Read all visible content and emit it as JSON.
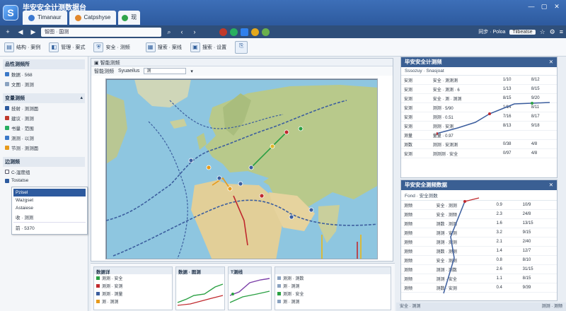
{
  "window": {
    "app_title": "毕安安全计测数据台",
    "tabs": [
      "Timanaur",
      "Catpshyse",
      "现"
    ],
    "controls": [
      "—",
      "▢",
      "✕"
    ]
  },
  "addressbar": {
    "url": "智图 · 国测",
    "right_text": "同步 · Poloa",
    "right_text2": "Tilbeatse"
  },
  "ribbon": {
    "buttons": [
      "结构 · 案例",
      "管理 · 案式",
      "安全 · 测频",
      "搜索 · 案线",
      "搜索 · 设置"
    ]
  },
  "sidebar": {
    "section1": {
      "title": "品性测频所",
      "items": [
        "数据 · 568",
        "文图 · 测测"
      ]
    },
    "section2": {
      "title": "变量测频",
      "items": [
        "技射 · 测测面",
        "建议 · 测测",
        "书量 · 范围",
        "测测 · 以测",
        "节测 · 测测面"
      ]
    },
    "section3": {
      "title": "边测频",
      "items": [
        "C-湿度组",
        "Tostatse"
      ],
      "menu": [
        "Pzisel",
        "Wazgset",
        "Astaiese",
        "收 · 测测",
        "前 · 5370"
      ]
    }
  },
  "map_panel": {
    "header": "智能测频",
    "toolbar_label": "智能测频",
    "toolbar_extra": "Syuaeilus",
    "search_placeholder": "测",
    "colors": {
      "ocean": "#8ec6e0",
      "land": "#c9cf9c",
      "desert": "#e2cf98",
      "route_blue": "#3c5e9e",
      "route_green": "#2aa043",
      "route_red": "#c0292e",
      "route_orange": "#e79a1b",
      "route_yellow": "#e0b82b"
    }
  },
  "right_top": {
    "title": "毕安安全计测频",
    "subtitle": "Sssozuy · Snasjoat",
    "rows": [
      [
        "安测",
        "安全 · 测测测",
        "1/10",
        "8/12"
      ],
      [
        "安测",
        "安全 · 测测 · 6",
        "1/13",
        "8/15"
      ],
      [
        "安测",
        "安全 · 测 · 测测",
        "8/15",
        "9/20"
      ],
      [
        "安测",
        "测测 · 5/90",
        "1/14",
        "8/11"
      ],
      [
        "安测",
        "测测 · 0.51",
        "7/16",
        "8/17"
      ],
      [
        "安测",
        "测测 · 安测",
        "8/13",
        "9/18"
      ],
      [
        "测量",
        "量量 · 0.97",
        "",
        ""
      ],
      [
        "测数",
        "测测 · 安测测",
        "0/38",
        "4/8"
      ],
      [
        "安测",
        "测测测 · 安全",
        "0/97",
        "4/8"
      ]
    ]
  },
  "right_bottom": {
    "title": "毕安安全测频数据",
    "subtitle": "Fond · 安全测数",
    "rows": [
      [
        "测频",
        "安全 · 测测",
        "0.9",
        "10/9"
      ],
      [
        "测频",
        "安全 · 测频",
        "2.3",
        "24/8"
      ],
      [
        "测频",
        "测数 · 测测",
        "1.6",
        "13/15"
      ],
      [
        "测频",
        "测测 · 安测",
        "3.2",
        "9/15"
      ],
      [
        "测频",
        "测测 · 测测",
        "2.1",
        "2/40"
      ],
      [
        "测频",
        "测数 · 测测",
        "1.4",
        "12/7"
      ],
      [
        "测频",
        "安全 · 测测",
        "0.8",
        "8/10"
      ],
      [
        "测频",
        "测测 · 测数",
        "2.6",
        "31/15"
      ],
      [
        "测频",
        "测测 · 安全",
        "1.1",
        "8/15"
      ],
      [
        "测频",
        "测数 · 安测",
        "0.4",
        "9/39"
      ]
    ]
  },
  "bottom": {
    "w1_title": "数据详",
    "w1_rows": [
      "测测 · 安全",
      "测测 · 安测",
      "测测 · 测量",
      "测 · 测测"
    ],
    "w2_title": "数据 · 图测",
    "w3_title": "T测线",
    "w4_rows": [
      "测测 · 测数",
      "测 · 测测",
      "测测 · 安全",
      "测 · 测测"
    ]
  },
  "statusbar": {
    "left": "安全 · 测测",
    "right": "测测 · 测频"
  }
}
